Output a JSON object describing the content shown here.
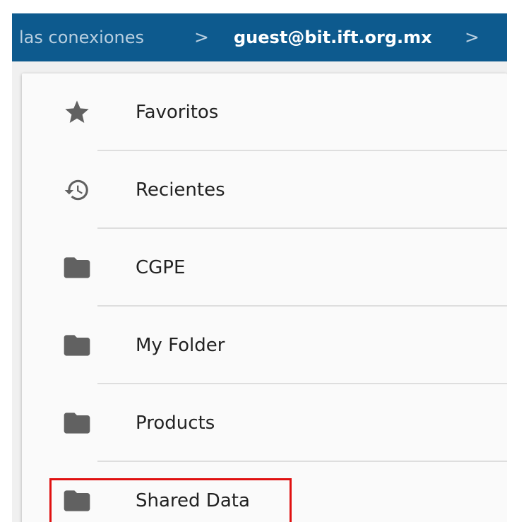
{
  "breadcrumb": {
    "items": [
      {
        "label": "las conexiones"
      },
      {
        "label": "guest@bit.ift.org.mx"
      }
    ],
    "separator": ">"
  },
  "list": {
    "items": [
      {
        "label": "Favoritos",
        "icon": "star-icon"
      },
      {
        "label": "Recientes",
        "icon": "history-icon"
      },
      {
        "label": "CGPE",
        "icon": "folder-icon"
      },
      {
        "label": "My Folder",
        "icon": "folder-icon"
      },
      {
        "label": "Products",
        "icon": "folder-icon"
      },
      {
        "label": "Shared Data",
        "icon": "folder-icon"
      }
    ]
  },
  "highlight": {
    "target": "Shared Data",
    "color": "#e01010"
  },
  "colors": {
    "header": "#0d5a8e",
    "icon": "#616161",
    "text": "#222222"
  }
}
